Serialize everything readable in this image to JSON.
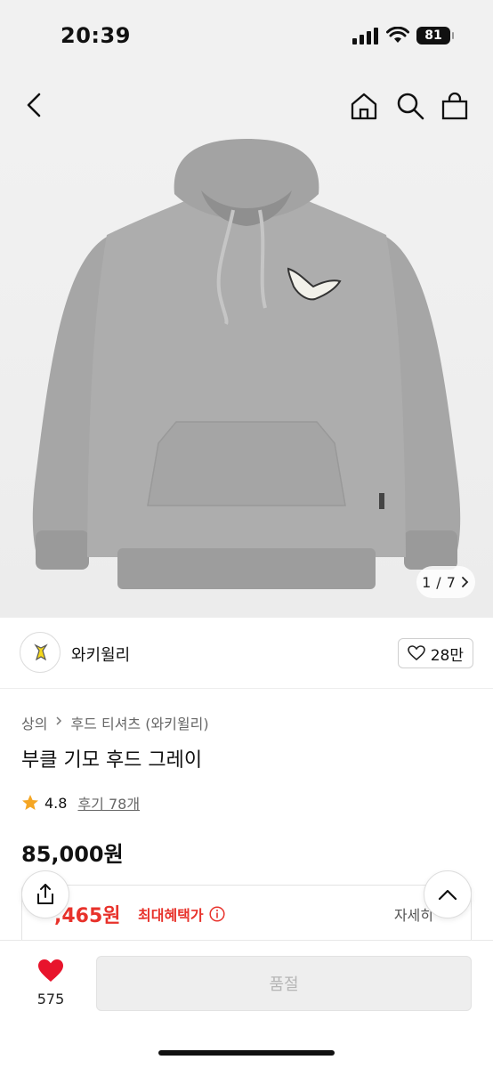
{
  "status_bar": {
    "time": "20:39",
    "battery": "81"
  },
  "gallery": {
    "current": "1",
    "separator": "/",
    "total": "7"
  },
  "brand": {
    "name": "와키윌리",
    "likes": "28만"
  },
  "breadcrumb": {
    "category": "상의",
    "sub": "후드 티셔츠 (와키윌리)"
  },
  "product": {
    "title": "부클 기모 후드 그레이",
    "rating": "4.8",
    "reviews": "후기 78개",
    "price": "85,000원"
  },
  "benefit": {
    "amount": ",465원",
    "label": "최대혜택가",
    "detail": "자세히"
  },
  "bottom_bar": {
    "wish_count": "575",
    "buy_label": "품절"
  },
  "colors": {
    "accent_red": "#e8322b",
    "heart_red": "#e8142c",
    "star": "#f5a623"
  }
}
